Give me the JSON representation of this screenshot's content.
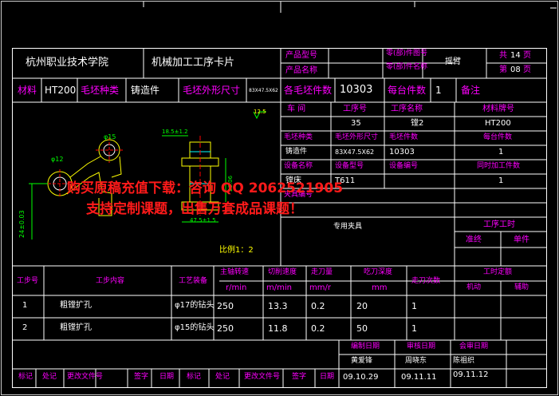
{
  "header": {
    "school": "杭州职业技术学院",
    "card_title": "机械加工工序卡片",
    "product_model_label": "产品型号",
    "product_name_label": "产品名称",
    "part_no_label": "零(部)件图号",
    "part_name_label": "零(部)件名称",
    "part_name_value": "摇臂",
    "total_pages_label": "共",
    "total_pages_value": "14",
    "total_pages_unit": "页",
    "page_label": "第",
    "page_value": "08",
    "page_unit": "页"
  },
  "material_row": {
    "material_label": "材料",
    "material_value": "HT200",
    "blank_type_label": "毛坯种类",
    "blank_type_value": "铸造件",
    "blank_size_label": "毛坯外形尺寸",
    "blank_size_value": "83X47.5X62",
    "blanks_count_label": "各毛坯件数",
    "blanks_count_value": "10303",
    "per_unit_label": "每台件数",
    "per_unit_value": "1",
    "remark_label": "备注"
  },
  "right_info": {
    "workshop_label": "车 间",
    "op_no_label": "工序号",
    "op_name_label": "工序名称",
    "material_no_label": "材料牌号",
    "op_no_value": "35",
    "op_name_value": "镗2",
    "material_no_value": "HT200",
    "blank_kind_label": "毛坯种类",
    "blank_dim_label": "毛坯外形尺寸",
    "blank_pieces_label": "毛坯件数",
    "per_set_label": "每台件数",
    "blank_kind_value": "铸造件",
    "blank_dim_value": "83X47.5X62",
    "blank_pieces_value": "10303",
    "per_set_value": "1",
    "equip_name_label": "设备名称",
    "equip_model_label": "设备型号",
    "equip_no_label": "设备编号",
    "concurrent_label": "同时加工件数",
    "equip_name_value": "镗床",
    "equip_model_value": "T611",
    "concurrent_value": "1",
    "fixture_label": "夹具编号",
    "fixture_value": "专用夹具",
    "op_hours_label": "工序工时",
    "prep_label": "准终",
    "unit_label": "单件"
  },
  "drawing": {
    "roughness": "12.5",
    "dim_top": "18.5±1.2",
    "dim_phi15": "φ15",
    "dim_phi12": "φ12",
    "dim_left": "24±0.03",
    "dim_height": "23.06",
    "dim_bottom": "47.5±1.5",
    "scale": "比例1：2"
  },
  "steps_table": {
    "headers": {
      "step_no": "工步号",
      "step_content": "工步内容",
      "equipment": "工艺装备",
      "spindle": "主轴转速",
      "spindle_unit": "r/min",
      "speed": "切削速度",
      "speed_unit": "m/min",
      "feed": "走刀量",
      "feed_unit": "mm/r",
      "depth": "吃刀深度",
      "depth_unit": "mm",
      "passes": "走刀次数",
      "time_quota": "工时定额",
      "machine": "机动",
      "aux": "辅助"
    },
    "rows": [
      {
        "no": "1",
        "content": "粗镗扩孔",
        "equip": "φ17的钻头",
        "spindle": "250",
        "speed": "13.3",
        "feed": "0.2",
        "depth": "20",
        "passes": "1"
      },
      {
        "no": "2",
        "content": "粗镗扩孔",
        "equip": "φ15的钻头",
        "spindle": "250",
        "speed": "11.8",
        "feed": "0.2",
        "depth": "50",
        "passes": "1"
      }
    ]
  },
  "signoff": {
    "design_date_label": "编制日期",
    "review_date_label": "审核日期",
    "approve_date_label": "会审日期",
    "designer": "黄爱锋",
    "reviewer": "周晓东",
    "approver": "陈祖织",
    "design_date": "09.10.29",
    "review_date": "09.11.11",
    "approve_date": "09.11.12",
    "footer_labels": [
      "标记",
      "处记",
      "更改文件号",
      "签字",
      "日期",
      "标记",
      "处记",
      "更改文件号",
      "签字",
      "日期"
    ]
  },
  "watermark": {
    "line1": "购买原稿充值下载：咨询 QQ 2062521905",
    "line2": "支持定制课题，出售万套成品课题！"
  },
  "colors": {
    "background": "#000000",
    "line": "#ffffff",
    "label": "#ff00ff",
    "value": "#ffffff",
    "dimension": "#00ff00",
    "drawing": "#ffff00",
    "watermark": "#ff1a1a"
  }
}
